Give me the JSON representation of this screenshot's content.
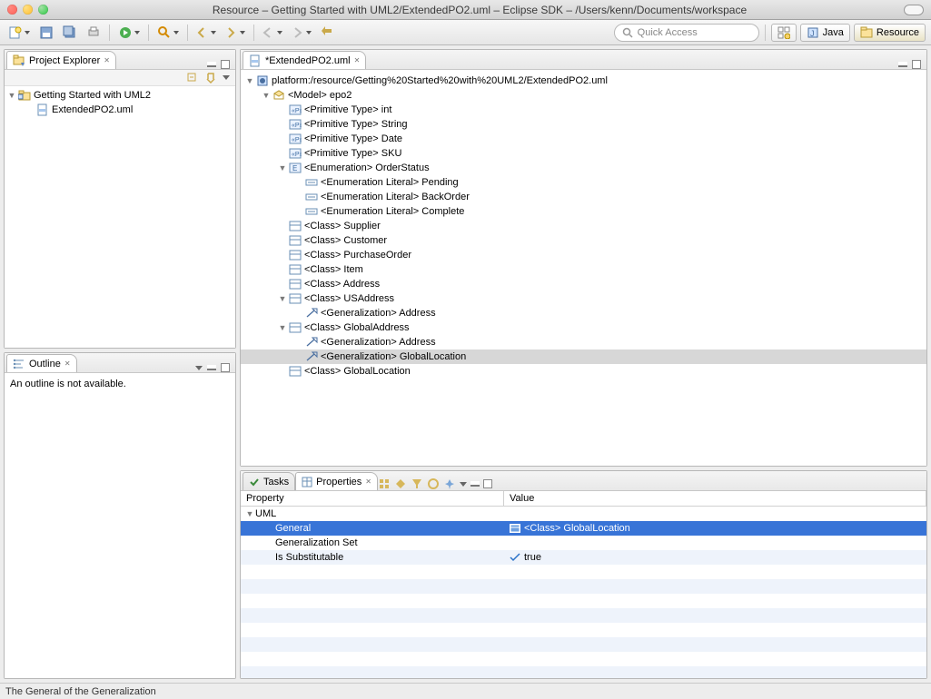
{
  "window_title": "Resource – Getting Started with UML2/ExtendedPO2.uml – Eclipse SDK – /Users/kenn/Documents/workspace",
  "quick_access_placeholder": "Quick Access",
  "perspectives": {
    "java": "Java",
    "resource": "Resource"
  },
  "project_explorer": {
    "title": "Project Explorer",
    "project": "Getting Started with UML2",
    "file": "ExtendedPO2.uml"
  },
  "outline": {
    "title": "Outline",
    "message": "An outline is not available."
  },
  "editor": {
    "tab": "*ExtendedPO2.uml",
    "root": "platform:/resource/Getting%20Started%20with%20UML2/ExtendedPO2.uml",
    "model": "<Model> epo2",
    "prim_int": "<Primitive Type> int",
    "prim_string": "<Primitive Type> String",
    "prim_date": "<Primitive Type> Date",
    "prim_sku": "<Primitive Type> SKU",
    "enum": "<Enumeration> OrderStatus",
    "enum_pending": "<Enumeration Literal> Pending",
    "enum_backorder": "<Enumeration Literal> BackOrder",
    "enum_complete": "<Enumeration Literal> Complete",
    "cls_supplier": "<Class> Supplier",
    "cls_customer": "<Class> Customer",
    "cls_po": "<Class> PurchaseOrder",
    "cls_item": "<Class> Item",
    "cls_address": "<Class> Address",
    "cls_usaddress": "<Class> USAddress",
    "gen_address_1": "<Generalization> Address",
    "cls_globaladdress": "<Class> GlobalAddress",
    "gen_address_2": "<Generalization> Address",
    "gen_globallocation": "<Generalization> GlobalLocation",
    "cls_globallocation": "<Class> GlobalLocation"
  },
  "tabs": {
    "tasks": "Tasks",
    "properties": "Properties"
  },
  "properties": {
    "col_property": "Property",
    "col_value": "Value",
    "cat": "UML",
    "row_general": "General",
    "row_general_value": "<Class> GlobalLocation",
    "row_genset": "Generalization Set",
    "row_subst": "Is Substitutable",
    "row_subst_value": "true"
  },
  "status": "The General of the Generalization"
}
